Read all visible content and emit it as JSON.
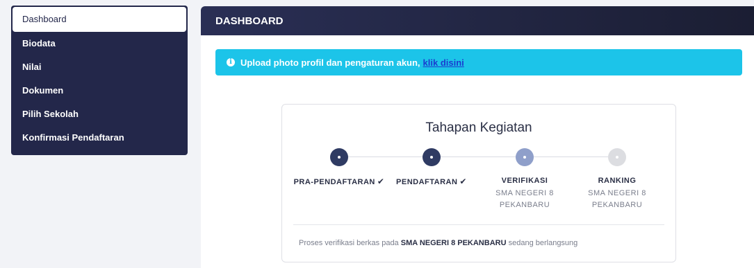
{
  "sidebar": {
    "items": [
      {
        "label": "Dashboard"
      },
      {
        "label": "Biodata"
      },
      {
        "label": "Nilai"
      },
      {
        "label": "Dokumen"
      },
      {
        "label": "Pilih Sekolah"
      },
      {
        "label": "Konfirmasi Pendaftaran"
      }
    ],
    "active_item": "Dashboard"
  },
  "header": {
    "title": "DASHBOARD"
  },
  "alert": {
    "text": "Upload photo profil dan pengaturan akun,",
    "link_label": "klik disini",
    "color": "#1cc4e9"
  },
  "progress": {
    "title": "Tahapan Kegiatan",
    "steps": [
      {
        "label": "PRA-PENDAFTARAN",
        "check": "✔",
        "status": "completed",
        "sub1": "",
        "sub2": ""
      },
      {
        "label": "PENDAFTARAN",
        "check": "✔",
        "status": "completed",
        "sub1": "",
        "sub2": ""
      },
      {
        "label": "VERIFIKASI",
        "check": "",
        "status": "current",
        "sub1": "SMA NEGERI 8",
        "sub2": "PEKANBARU"
      },
      {
        "label": "RANKING",
        "check": "",
        "status": "upcoming",
        "sub1": "SMA NEGERI 8",
        "sub2": "PEKANBARU"
      }
    ],
    "status_colors": {
      "completed": "#2f3b63",
      "current": "#8f9fca",
      "upcoming": "#dcdde1"
    },
    "note_prefix": "Proses verifikasi berkas pada",
    "note_school": "SMA NEGERI 8 PEKANBARU",
    "note_suffix": "sedang berlangsung"
  }
}
